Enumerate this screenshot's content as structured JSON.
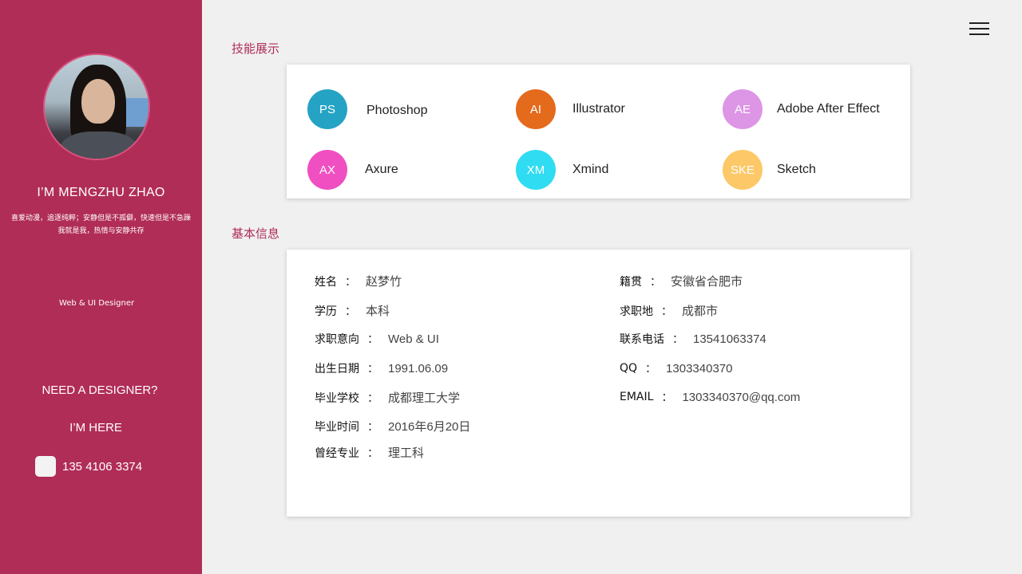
{
  "profile": {
    "name": "I’M MENGZHU ZHAO",
    "motto_line1": "喜爱动漫，追逐纯粹；安静但是不孤僻，快速但是不急躁",
    "motto_line2": "我就是我，热情与安静共存",
    "role": "Web & UI Designer",
    "cta": "NEED A DESIGNER?",
    "here": "I’M HERE",
    "phone": "135 4106 3374"
  },
  "skills": {
    "title": "技能展示",
    "items": [
      {
        "abbr": "PS",
        "name": "Photoshop",
        "color": "#25a3c4"
      },
      {
        "abbr": "AI",
        "name": "Illustrator",
        "color": "#e46a1c"
      },
      {
        "abbr": "AE",
        "name": "Adobe After Effect",
        "color": "#dd95e6"
      },
      {
        "abbr": "AX",
        "name": "Axure",
        "color": "#ef4fc1"
      },
      {
        "abbr": "XM",
        "name": "Xmind",
        "color": "#2fdcf1"
      },
      {
        "abbr": "SKE",
        "name": "Sketch",
        "color": "#fcc868"
      }
    ]
  },
  "info": {
    "title": "基本信息",
    "items": [
      {
        "label": "姓名",
        "value": "赵梦竹"
      },
      {
        "label": "学历",
        "value": "本科"
      },
      {
        "label": "求职意向",
        "value": "Web & UI"
      },
      {
        "label": "出生日期",
        "value": "1991.06.09"
      },
      {
        "label": "毕业学校",
        "value": "成都理工大学"
      },
      {
        "label": "毕业时间",
        "value": "2016年6月20日"
      },
      {
        "label": "曾经专业",
        "value": "理工科"
      },
      {
        "label": "籍贯",
        "value": "安徽省合肥市"
      },
      {
        "label": "求职地",
        "value": "成都市"
      },
      {
        "label": "联系电话",
        "value": "13541063374"
      },
      {
        "label": "QQ",
        "value": "1303340370"
      },
      {
        "label": "EMAIL",
        "value": "1303340370@qq.com"
      }
    ],
    "colon": "："
  },
  "colors": {
    "accent": "#b02d58",
    "background": "#f0f0f0",
    "card": "#ffffff"
  },
  "icons": {
    "menu": "hamburger-menu-icon",
    "phone": "phone-icon"
  }
}
